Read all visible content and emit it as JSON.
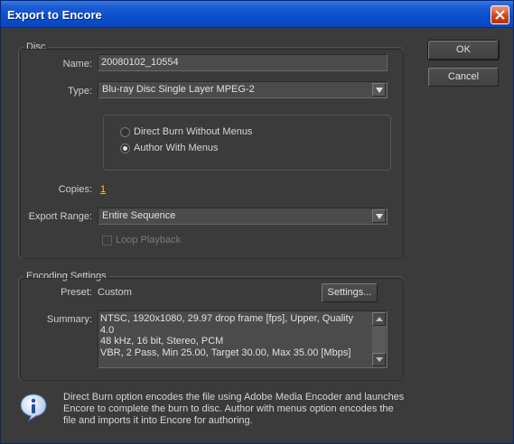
{
  "window": {
    "title": "Export to Encore"
  },
  "disc": {
    "legend": "Disc",
    "name_label": "Name:",
    "name_value": "20080102_10554",
    "type_label": "Type:",
    "type_value": "Blu-ray Disc Single Layer MPEG-2",
    "radio_direct": "Direct Burn Without Menus",
    "radio_author": "Author With Menus",
    "copies_label": "Copies:",
    "copies_value": "1",
    "range_label": "Export Range:",
    "range_value": "Entire Sequence",
    "loop_label": "Loop Playback"
  },
  "encoding": {
    "legend": "Encoding Settings",
    "preset_label": "Preset:",
    "preset_value": "Custom",
    "settings_button": "Settings...",
    "summary_label": "Summary:",
    "summary_line1": "NTSC, 1920x1080, 29.97 drop frame [fps], Upper, Quality",
    "summary_line2": "4.0",
    "summary_line3": "48 kHz, 16 bit, Stereo, PCM",
    "summary_line4": "VBR, 2 Pass, Min 25.00, Target 30.00, Max 35.00 [Mbps]"
  },
  "buttons": {
    "ok": "OK",
    "cancel": "Cancel"
  },
  "info": {
    "line1": "Direct Burn option encodes the file using Adobe Media Encoder and launches",
    "line2": "Encore to complete the burn to disc. Author with menus option encodes the",
    "line3": "file and imports it into Encore for authoring."
  },
  "colors": {
    "titlebar": "#0a4fcf",
    "link": "#f0c030",
    "background": "#3b3b3b"
  }
}
